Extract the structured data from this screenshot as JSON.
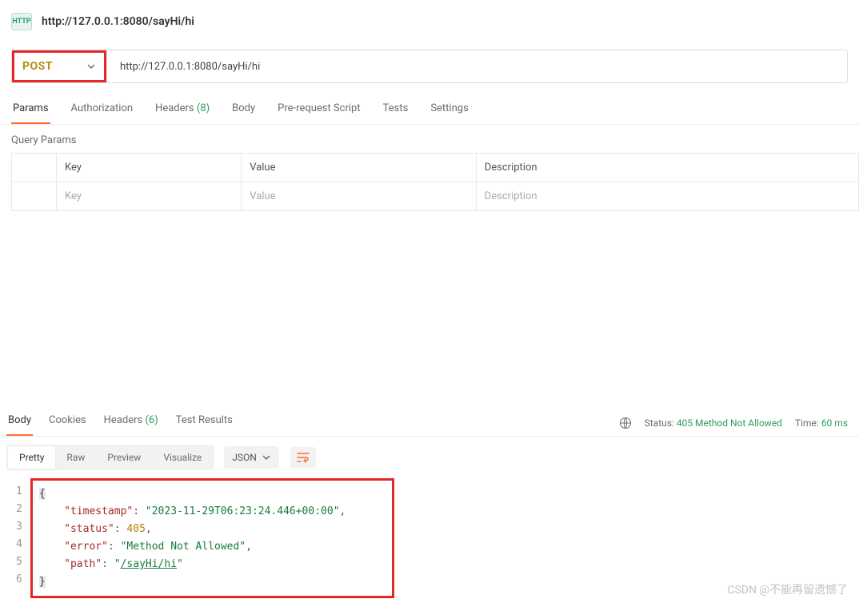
{
  "header": {
    "badge": "HTTP",
    "title": "http://127.0.0.1:8080/sayHi/hi"
  },
  "request": {
    "method": "POST",
    "url": "http://127.0.0.1:8080/sayHi/hi"
  },
  "reqTabs": {
    "params": "Params",
    "auth": "Authorization",
    "headers": "Headers",
    "headersCount": "(8)",
    "body": "Body",
    "prereq": "Pre-request Script",
    "tests": "Tests",
    "settings": "Settings"
  },
  "paramsSection": {
    "title": "Query Params",
    "cols": {
      "key": "Key",
      "value": "Value",
      "desc": "Description"
    },
    "placeholders": {
      "key": "Key",
      "value": "Value",
      "desc": "Description"
    }
  },
  "respTabs": {
    "body": "Body",
    "cookies": "Cookies",
    "headers": "Headers",
    "headersCount": "(6)",
    "tests": "Test Results"
  },
  "respMeta": {
    "statusLabel": "Status:",
    "statusValue": "405 Method Not Allowed",
    "timeLabel": "Time:",
    "timeValue": "60 ms"
  },
  "bodyToolbar": {
    "pretty": "Pretty",
    "raw": "Raw",
    "preview": "Preview",
    "visualize": "Visualize",
    "format": "JSON"
  },
  "responseBody": {
    "timestampKey": "\"timestamp\"",
    "timestampVal": "\"2023-11-29T06:23:24.446+00:00\"",
    "statusKey": "\"status\"",
    "statusVal": "405",
    "errorKey": "\"error\"",
    "errorVal": "\"Method Not Allowed\"",
    "pathKey": "\"path\"",
    "pathValPrefix": "\"",
    "pathValLink": "/sayHi/hi",
    "pathValSuffix": "\"",
    "line1": "1",
    "line2": "2",
    "line3": "3",
    "line4": "4",
    "line5": "5",
    "line6": "6"
  },
  "watermark": "CSDN @不能再留遗憾了"
}
